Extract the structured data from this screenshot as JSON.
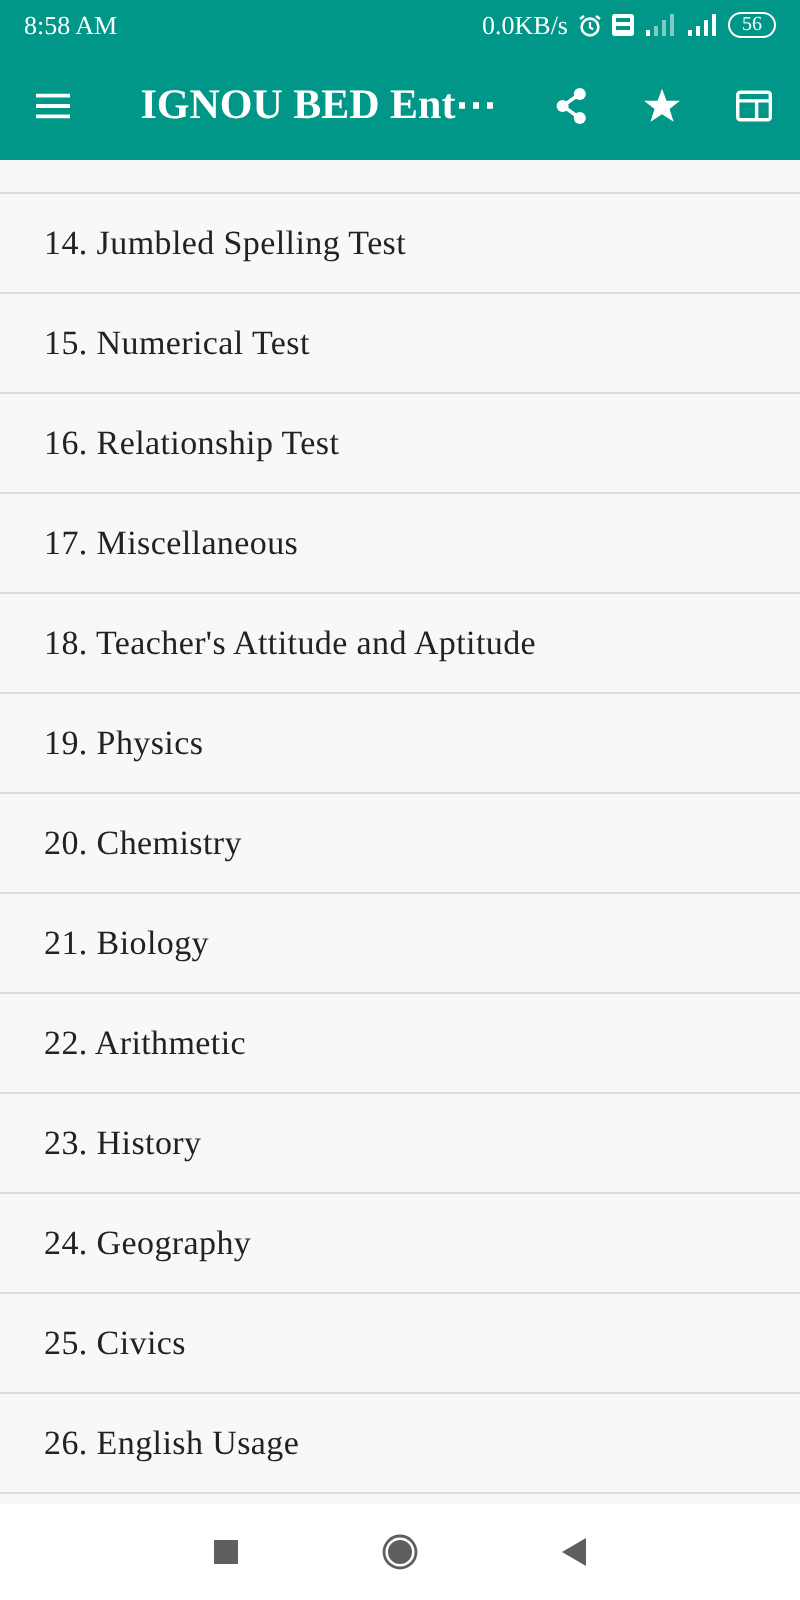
{
  "status_bar": {
    "time": "8:58 AM",
    "speed": "0.0KB/s",
    "battery": "56"
  },
  "app_bar": {
    "title": "IGNOU BED Ent⋯"
  },
  "items": [
    {
      "label": "14. Jumbled Spelling Test"
    },
    {
      "label": "15. Numerical Test"
    },
    {
      "label": "16. Relationship Test"
    },
    {
      "label": "17. Miscellaneous"
    },
    {
      "label": "18. Teacher's Attitude and Aptitude"
    },
    {
      "label": "19. Physics"
    },
    {
      "label": "20. Chemistry"
    },
    {
      "label": "21. Biology"
    },
    {
      "label": "22. Arithmetic"
    },
    {
      "label": "23. History"
    },
    {
      "label": "24. Geography"
    },
    {
      "label": "25. Civics"
    },
    {
      "label": "26. English Usage"
    }
  ]
}
